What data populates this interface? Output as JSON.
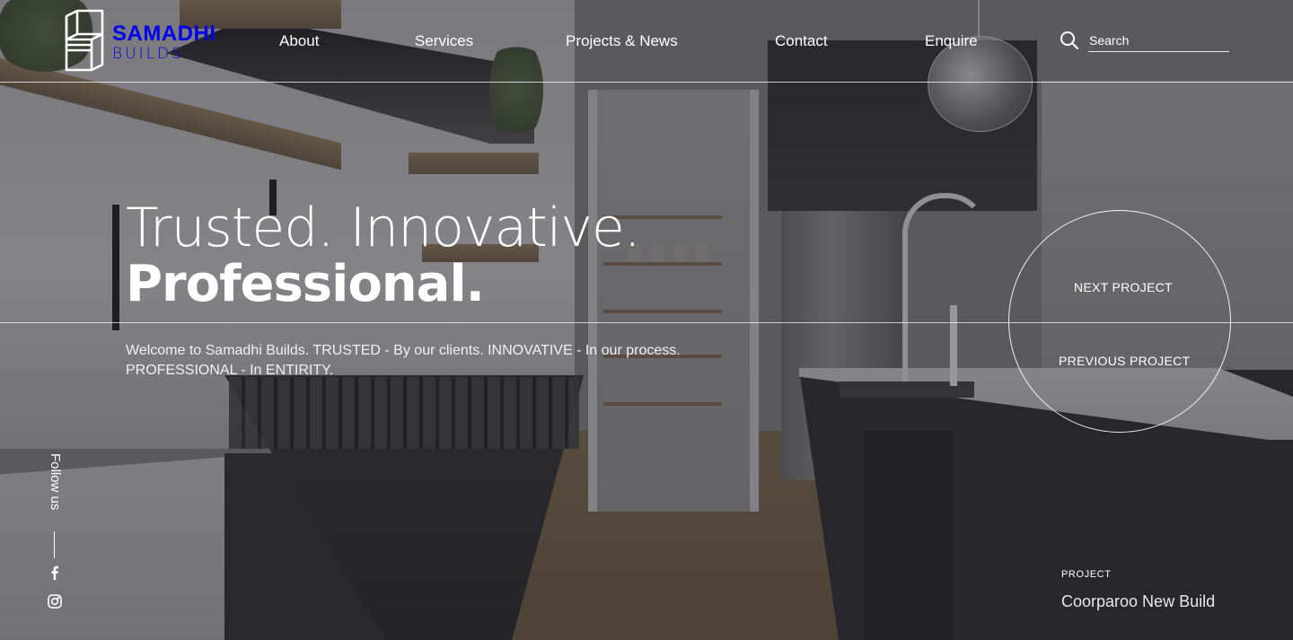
{
  "brand": {
    "name": "SAMADHI",
    "sub": "BUILDS"
  },
  "nav": {
    "items": [
      {
        "label": "About"
      },
      {
        "label": "Services"
      },
      {
        "label": "Projects & News"
      },
      {
        "label": "Contact"
      },
      {
        "label": "Enquire"
      }
    ]
  },
  "search": {
    "icon": "search-icon",
    "placeholder": "Search"
  },
  "hero": {
    "line1": "Trusted. Innovative.",
    "line2": "Professional.",
    "description": "Welcome to Samadhi Builds. TRUSTED - By our clients. INNOVATIVE - In our process. PROFESSIONAL - In ENTIRITY."
  },
  "project_nav": {
    "next_label": "NEXT PROJECT",
    "previous_label": "PREVIOUS PROJECT"
  },
  "social": {
    "follow_label": "Follow us",
    "icons": [
      "facebook-icon",
      "instagram-icon"
    ]
  },
  "project": {
    "kicker": "PROJECT",
    "name": "Coorparoo New Build"
  }
}
